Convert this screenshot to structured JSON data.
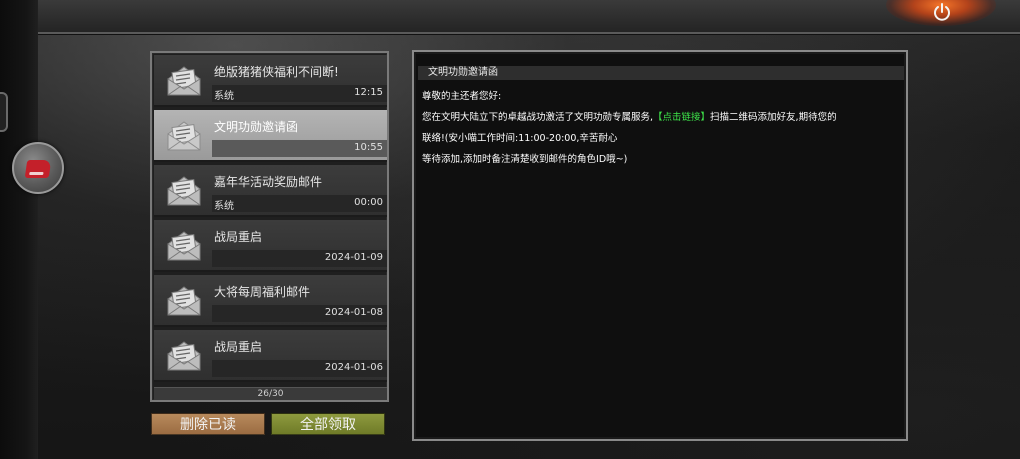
{
  "power": {
    "icon": "power-icon"
  },
  "side": {
    "icon": "mail-badge-icon"
  },
  "mail_list": [
    {
      "title": "绝版猪猪侠福利不间断!",
      "sender": "系统",
      "time": "12:15",
      "selected": false
    },
    {
      "title": "文明功勋邀请函",
      "sender": "",
      "time": "10:55",
      "selected": true
    },
    {
      "title": "嘉年华活动奖励邮件",
      "sender": "系统",
      "time": "00:00",
      "selected": false
    },
    {
      "title": "战局重启",
      "sender": "",
      "time": "2024-01-09",
      "selected": false
    },
    {
      "title": "大将每周福利邮件",
      "sender": "",
      "time": "2024-01-08",
      "selected": false
    },
    {
      "title": "战局重启",
      "sender": "",
      "time": "2024-01-06",
      "selected": false
    }
  ],
  "pager": "26/30",
  "buttons": {
    "delete_read": "删除已读",
    "claim_all": "全部领取"
  },
  "content": {
    "title": "文明功勋邀请函",
    "greeting": "尊敬的主还者您好:",
    "line1_pre": "您在文明大陆立下的卓越战功激活了文明功勋专属服务,",
    "line1_link": "【点击链接】",
    "line1_post": "扫描二维码添加好友,期待您的",
    "line2": "联络!(安小喵工作时间:11:00-20:00,辛苦耐心",
    "line3": "等待添加,添加时备注清楚收到邮件的角色ID哦~)"
  },
  "colors": {
    "link": "#3ee34a",
    "delete_button": "#b88a5c",
    "claim_button": "#8e9a3e"
  }
}
